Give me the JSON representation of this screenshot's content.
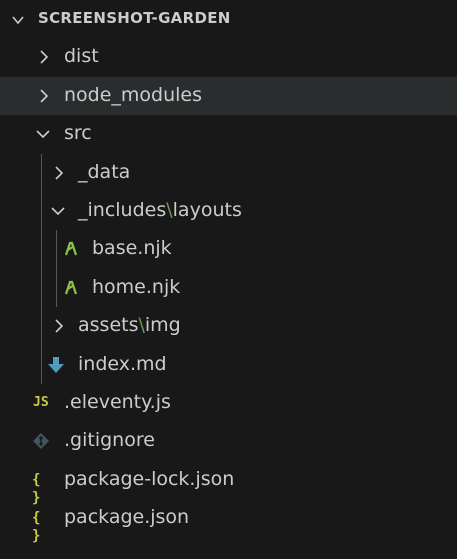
{
  "explorer": {
    "title": "SCREENSHOT-GARDEN",
    "items": [
      {
        "label": "dist"
      },
      {
        "label": "node_modules"
      },
      {
        "label": "src"
      },
      {
        "label": "_data"
      },
      {
        "segments": [
          "_includes",
          "\\",
          "layouts"
        ]
      },
      {
        "label": "base.njk"
      },
      {
        "label": "home.njk"
      },
      {
        "segments": [
          "assets",
          "\\",
          "img"
        ]
      },
      {
        "label": "index.md"
      },
      {
        "label": ".eleventy.js",
        "icon_text": "JS"
      },
      {
        "label": ".gitignore"
      },
      {
        "label": "package-lock.json",
        "icon_text": "{ }"
      },
      {
        "label": "package.json",
        "icon_text": "{ }"
      }
    ]
  },
  "colors": {
    "background": "#181818",
    "hover_row": "#2a2d2e",
    "text": "#cccccc",
    "js_icon": "#cbcb41",
    "json_icon": "#cbcb41",
    "markdown_icon": "#519aba",
    "nunjucks_icon": "#8dc149",
    "git_icon": "#41535b",
    "path_separator": "#6a9955"
  },
  "icons": {
    "collapsed": "chevron-right-icon",
    "expanded": "chevron-down-icon",
    "njk": "nunjucks-file-icon",
    "md": "markdown-file-icon",
    "js": "javascript-file-icon",
    "git": "git-file-icon",
    "json": "json-file-icon"
  }
}
